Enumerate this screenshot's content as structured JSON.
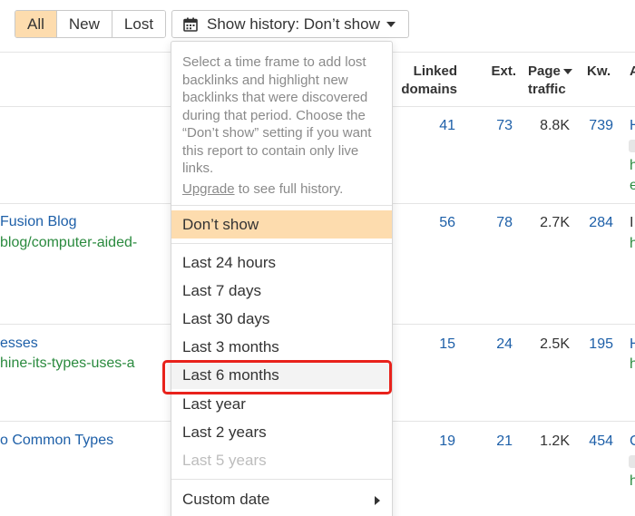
{
  "filter_tabs": [
    {
      "label": "All",
      "active": true
    },
    {
      "label": "New",
      "active": false
    },
    {
      "label": "Lost",
      "active": false
    }
  ],
  "history_button": {
    "label": "Show history: Don’t show",
    "icon": "calendar-icon"
  },
  "columns": {
    "linked_domains": [
      "Linked",
      "domains"
    ],
    "ext": "Ext.",
    "page_traffic": [
      "Page",
      "traffic"
    ],
    "kw": "Kw.",
    "next": "A"
  },
  "rows": [
    {
      "title": "",
      "url": "",
      "linked_domains": "41",
      "ext": "73",
      "traffic": "8.8K",
      "kw": "739",
      "edge": [
        "H",
        "h",
        "e"
      ]
    },
    {
      "title": "Fusion Blog",
      "url": "blog/computer-aided-",
      "linked_domains": "56",
      "ext": "78",
      "traffic": "2.7K",
      "kw": "284",
      "edge": [
        "I",
        "h"
      ]
    },
    {
      "title": "esses",
      "url": "hine-its-types-uses-a",
      "linked_domains": "15",
      "ext": "24",
      "traffic": "2.5K",
      "kw": "195",
      "edge": [
        "H",
        "h"
      ]
    },
    {
      "title": "o Common Types",
      "url": "",
      "linked_domains": "19",
      "ext": "21",
      "traffic": "1.2K",
      "kw": "454",
      "edge": [
        "C",
        "h"
      ]
    }
  ],
  "dropdown": {
    "help_text": "Select a time frame to add lost backlinks and highlight new backlinks that were discovered during that period. Choose the “Don’t show” setting if you want this report to contain only live links.",
    "upgrade_link": "Upgrade",
    "upgrade_suffix": " to see full history.",
    "selected_option": "Don’t show",
    "options": [
      "Last 24 hours",
      "Last 7 days",
      "Last 30 days",
      "Last 3 months",
      "Last 6 months",
      "Last year",
      "Last 2 years",
      "Last 5 years"
    ],
    "disabled_option": "Last 5 years",
    "custom_option": "Custom date"
  },
  "colors": {
    "accent": "#fddcae",
    "link": "#1d5fa8",
    "url": "#2a8a3e",
    "highlight_box": "#e8221b"
  }
}
